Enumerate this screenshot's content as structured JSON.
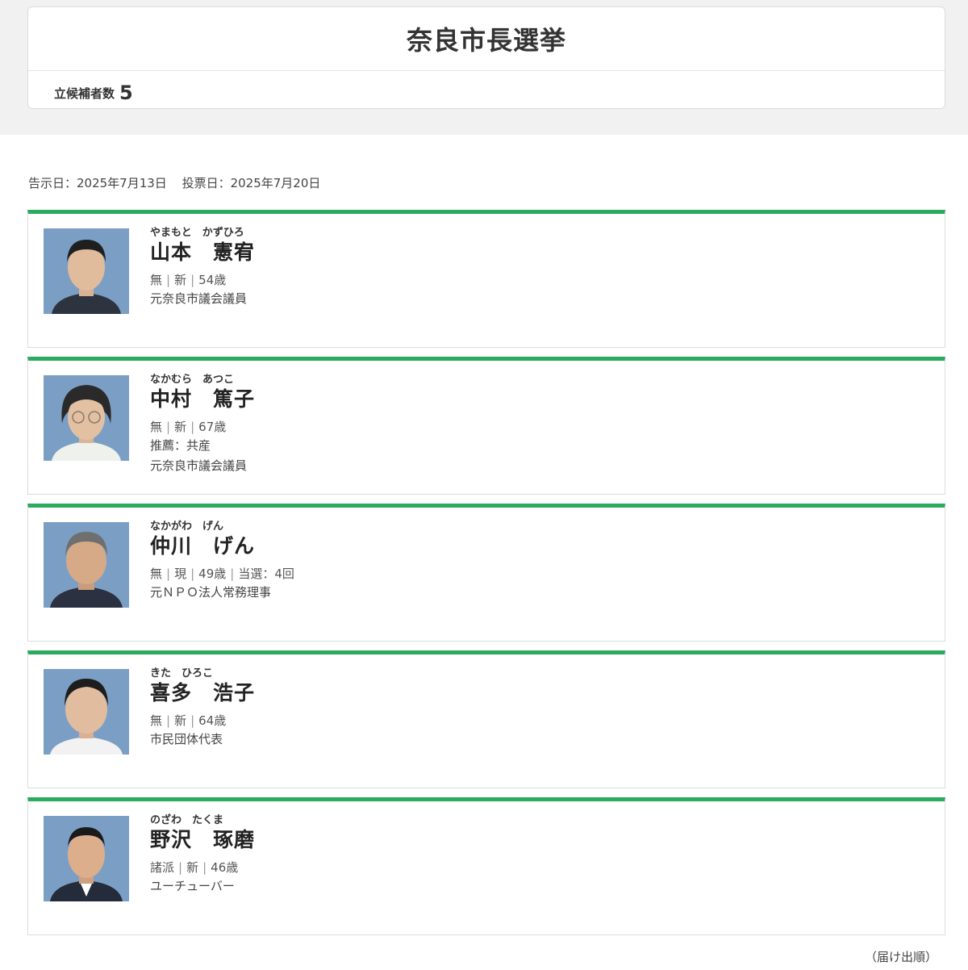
{
  "election": {
    "title": "奈良市長選挙",
    "candidate_count_label": "立候補者数",
    "candidate_count": "5",
    "notice_date": "告示日：2025年7月13日",
    "voting_date": "投票日：2025年7月20日"
  },
  "candidates": [
    {
      "kana": "やまもと　かずひろ",
      "name": "山本　憲宥",
      "party": "無",
      "status": "新",
      "age": "54歳",
      "lines": [
        "元奈良市議会議員"
      ]
    },
    {
      "kana": "なかむら　あつこ",
      "name": "中村　篤子",
      "party": "無",
      "status": "新",
      "age": "67歳",
      "lines": [
        "推薦：共産",
        "元奈良市議会議員"
      ]
    },
    {
      "kana": "なかがわ　げん",
      "name": "仲川　げん",
      "party": "無",
      "status": "現",
      "age": "49歳",
      "elected": "当選：4回",
      "lines": [
        "元ＮＰＯ法人常務理事"
      ]
    },
    {
      "kana": "きた　ひろこ",
      "name": "喜多　浩子",
      "party": "無",
      "status": "新",
      "age": "64歳",
      "lines": [
        "市民団体代表"
      ]
    },
    {
      "kana": "のざわ　たくま",
      "name": "野沢　琢磨",
      "party": "諸派",
      "status": "新",
      "age": "46歳",
      "lines": [
        "ユーチューバー"
      ]
    }
  ],
  "footnote": "（届け出順）",
  "colors": {
    "accent": "#2bab5e",
    "photo_background": "#7b9fc4"
  },
  "icons": [
    "candidate-photo"
  ]
}
